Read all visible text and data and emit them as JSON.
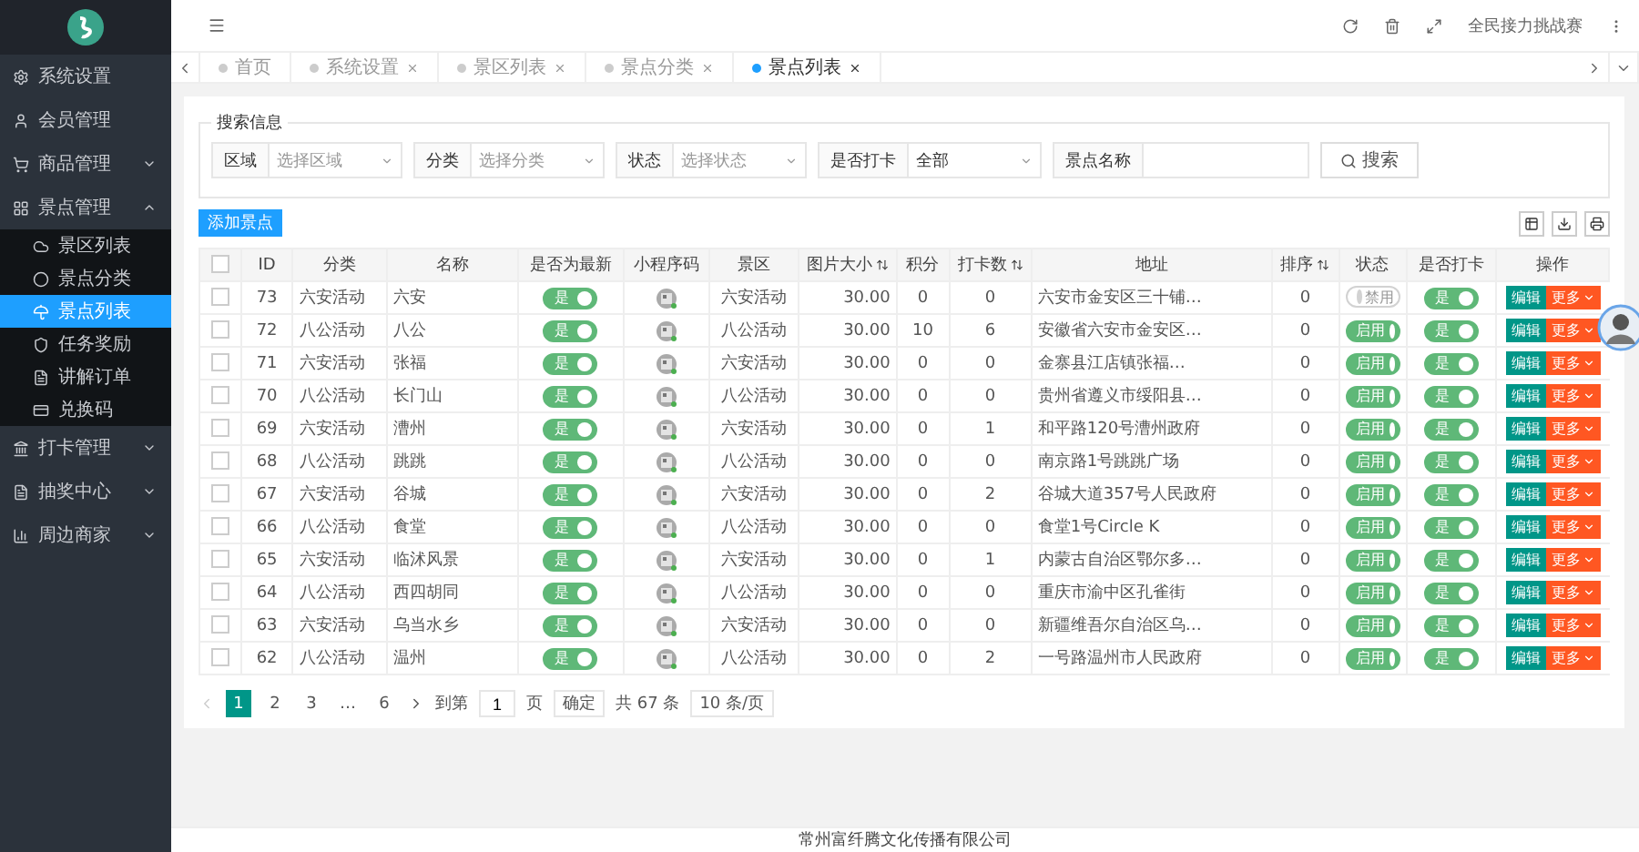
{
  "header": {
    "user": "全民接力挑战赛"
  },
  "sidebar": {
    "items": [
      {
        "label": "系统设置"
      },
      {
        "label": "会员管理"
      },
      {
        "label": "商品管理",
        "expanded": false
      },
      {
        "label": "景点管理",
        "expanded": true,
        "children": [
          {
            "label": "景区列表",
            "selected": false
          },
          {
            "label": "景点分类",
            "selected": false
          },
          {
            "label": "景点列表",
            "selected": true
          },
          {
            "label": "任务奖励",
            "selected": false
          },
          {
            "label": "讲解订单",
            "selected": false
          },
          {
            "label": "兑换码",
            "selected": false
          }
        ]
      },
      {
        "label": "打卡管理",
        "expanded": false
      },
      {
        "label": "抽奖中心",
        "expanded": false
      },
      {
        "label": "周边商家",
        "expanded": false
      }
    ]
  },
  "tabs": [
    {
      "label": "首页",
      "selected": false,
      "closable": false
    },
    {
      "label": "系统设置",
      "selected": false,
      "closable": true
    },
    {
      "label": "景区列表",
      "selected": false,
      "closable": true
    },
    {
      "label": "景点分类",
      "selected": false,
      "closable": true
    },
    {
      "label": "景点列表",
      "selected": true,
      "closable": true
    }
  ],
  "search": {
    "legend": "搜索信息",
    "filters": [
      {
        "kind": "select",
        "label": "区域",
        "placeholder": "选择区域"
      },
      {
        "kind": "select",
        "label": "分类",
        "placeholder": "选择分类"
      },
      {
        "kind": "select",
        "label": "状态",
        "placeholder": "选择状态"
      },
      {
        "kind": "select",
        "label": "是否打卡",
        "value": "全部"
      },
      {
        "kind": "text",
        "label": "景点名称"
      }
    ],
    "button": "搜索"
  },
  "add_button": "添加景点",
  "table": {
    "select_all_checked": false,
    "columns": [
      {
        "label": "ID",
        "sortable": false
      },
      {
        "label": "分类",
        "sortable": false
      },
      {
        "label": "名称",
        "sortable": false
      },
      {
        "label": "是否为最新",
        "sortable": false
      },
      {
        "label": "小程序码",
        "sortable": false
      },
      {
        "label": "景区",
        "sortable": false
      },
      {
        "label": "图片大小",
        "sortable": true
      },
      {
        "label": "积分",
        "sortable": false
      },
      {
        "label": "打卡数",
        "sortable": true
      },
      {
        "label": "地址",
        "sortable": false
      },
      {
        "label": "排序",
        "sortable": true
      },
      {
        "label": "状态",
        "sortable": false
      },
      {
        "label": "是否打卡",
        "sortable": false
      },
      {
        "label": "操作",
        "sortable": false
      }
    ],
    "rows": [
      {
        "checked": false,
        "id": "73",
        "category": "六安活动",
        "name": "六安",
        "latest": {
          "label": "是",
          "on": true
        },
        "area": "六安活动",
        "size": "30.00",
        "points": "0",
        "checkins": "0",
        "address": "六安市金安区三十铺…",
        "sort": "0",
        "status": {
          "label": "禁用",
          "on": false
        },
        "checkin": {
          "label": "是",
          "on": true
        },
        "actions": [
          "编辑",
          "更多"
        ]
      },
      {
        "checked": false,
        "id": "72",
        "category": "八公活动",
        "name": "八公",
        "latest": {
          "label": "是",
          "on": true
        },
        "area": "八公活动",
        "size": "30.00",
        "points": "10",
        "checkins": "6",
        "address": "安徽省六安市金安区…",
        "sort": "0",
        "status": {
          "label": "启用",
          "on": true
        },
        "checkin": {
          "label": "是",
          "on": true
        },
        "actions": [
          "编辑",
          "更多"
        ]
      },
      {
        "checked": false,
        "id": "71",
        "category": "六安活动",
        "name": "张福",
        "latest": {
          "label": "是",
          "on": true
        },
        "area": "六安活动",
        "size": "30.00",
        "points": "0",
        "checkins": "0",
        "address": "金寨县江店镇张福…",
        "sort": "0",
        "status": {
          "label": "启用",
          "on": true
        },
        "checkin": {
          "label": "是",
          "on": true
        },
        "actions": [
          "编辑",
          "更多"
        ]
      },
      {
        "checked": false,
        "id": "70",
        "category": "八公活动",
        "name": "长门山",
        "latest": {
          "label": "是",
          "on": true
        },
        "area": "八公活动",
        "size": "30.00",
        "points": "0",
        "checkins": "0",
        "address": "贵州省遵义市绥阳县…",
        "sort": "0",
        "status": {
          "label": "启用",
          "on": true
        },
        "checkin": {
          "label": "是",
          "on": true
        },
        "actions": [
          "编辑",
          "更多"
        ]
      },
      {
        "checked": false,
        "id": "69",
        "category": "六安活动",
        "name": "漕州",
        "latest": {
          "label": "是",
          "on": true
        },
        "area": "六安活动",
        "size": "30.00",
        "points": "0",
        "checkins": "1",
        "address": "和平路120号漕州政府",
        "sort": "0",
        "status": {
          "label": "启用",
          "on": true
        },
        "checkin": {
          "label": "是",
          "on": true
        },
        "actions": [
          "编辑",
          "更多"
        ]
      },
      {
        "checked": false,
        "id": "68",
        "category": "八公活动",
        "name": "跳跳",
        "latest": {
          "label": "是",
          "on": true
        },
        "area": "八公活动",
        "size": "30.00",
        "points": "0",
        "checkins": "0",
        "address": "南京路1号跳跳广场",
        "sort": "0",
        "status": {
          "label": "启用",
          "on": true
        },
        "checkin": {
          "label": "是",
          "on": true
        },
        "actions": [
          "编辑",
          "更多"
        ]
      },
      {
        "checked": false,
        "id": "67",
        "category": "六安活动",
        "name": "谷城",
        "latest": {
          "label": "是",
          "on": true
        },
        "area": "六安活动",
        "size": "30.00",
        "points": "0",
        "checkins": "2",
        "address": "谷城大道357号人民政府",
        "sort": "0",
        "status": {
          "label": "启用",
          "on": true
        },
        "checkin": {
          "label": "是",
          "on": true
        },
        "actions": [
          "编辑",
          "更多"
        ]
      },
      {
        "checked": false,
        "id": "66",
        "category": "八公活动",
        "name": "食堂",
        "latest": {
          "label": "是",
          "on": true
        },
        "area": "八公活动",
        "size": "30.00",
        "points": "0",
        "checkins": "0",
        "address": "食堂1号Circle K",
        "sort": "0",
        "status": {
          "label": "启用",
          "on": true
        },
        "checkin": {
          "label": "是",
          "on": true
        },
        "actions": [
          "编辑",
          "更多"
        ]
      },
      {
        "checked": false,
        "id": "65",
        "category": "六安活动",
        "name": "临沭风景",
        "latest": {
          "label": "是",
          "on": true
        },
        "area": "六安活动",
        "size": "30.00",
        "points": "0",
        "checkins": "1",
        "address": "内蒙古自治区鄂尔多…",
        "sort": "0",
        "status": {
          "label": "启用",
          "on": true
        },
        "checkin": {
          "label": "是",
          "on": true
        },
        "actions": [
          "编辑",
          "更多"
        ]
      },
      {
        "checked": false,
        "id": "64",
        "category": "八公活动",
        "name": "西四胡同",
        "latest": {
          "label": "是",
          "on": true
        },
        "area": "八公活动",
        "size": "30.00",
        "points": "0",
        "checkins": "0",
        "address": "重庆市渝中区孔雀街",
        "sort": "0",
        "status": {
          "label": "启用",
          "on": true
        },
        "checkin": {
          "label": "是",
          "on": true
        },
        "actions": [
          "编辑",
          "更多"
        ]
      },
      {
        "checked": false,
        "id": "63",
        "category": "六安活动",
        "name": "乌当水乡",
        "latest": {
          "label": "是",
          "on": true
        },
        "area": "六安活动",
        "size": "30.00",
        "points": "0",
        "checkins": "0",
        "address": "新疆维吾尔自治区乌…",
        "sort": "0",
        "status": {
          "label": "启用",
          "on": true
        },
        "checkin": {
          "label": "是",
          "on": true
        },
        "actions": [
          "编辑",
          "更多"
        ]
      },
      {
        "checked": false,
        "id": "62",
        "category": "八公活动",
        "name": "温州",
        "latest": {
          "label": "是",
          "on": true
        },
        "area": "八公活动",
        "size": "30.00",
        "points": "0",
        "checkins": "2",
        "address": "一号路温州市人民政府",
        "sort": "0",
        "status": {
          "label": "启用",
          "on": true
        },
        "checkin": {
          "label": "是",
          "on": true
        },
        "actions": [
          "编辑",
          "更多"
        ]
      }
    ]
  },
  "pagination": {
    "pages": [
      {
        "label": "1",
        "selected": true
      },
      {
        "label": "2",
        "selected": false
      },
      {
        "label": "3",
        "selected": false
      },
      {
        "label": "…",
        "selected": false
      },
      {
        "label": "6",
        "selected": false
      }
    ],
    "goto_label": "到第",
    "page_value": "1",
    "page_unit": "页",
    "confirm": "确定",
    "total": "共 67 条",
    "page_size": "10 条/页"
  },
  "footer": "常州富纤腾文化传播有限公司"
}
